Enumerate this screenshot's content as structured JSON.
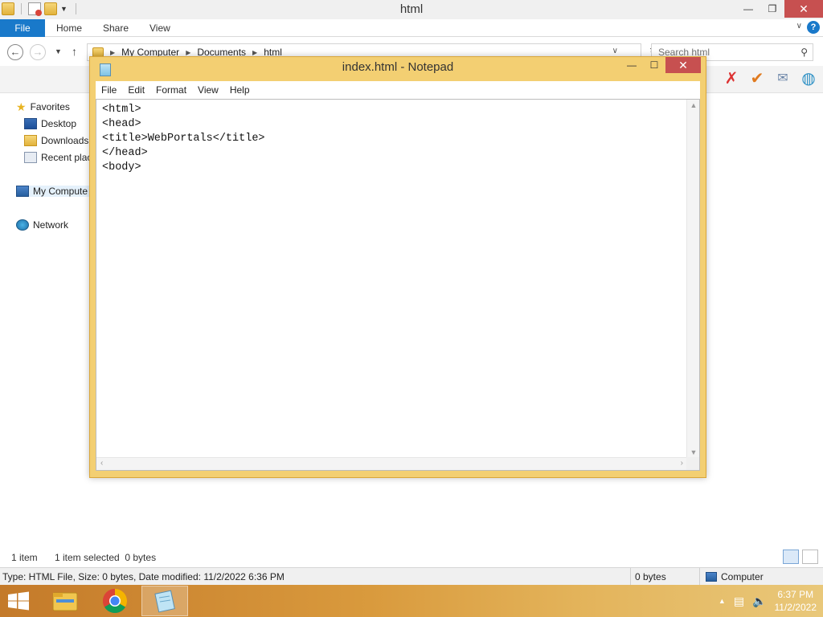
{
  "explorer": {
    "title": "html",
    "ribbon_tabs": [
      "File",
      "Home",
      "Share",
      "View"
    ],
    "breadcrumb": [
      "My Computer",
      "Documents",
      "html"
    ],
    "search_placeholder": "Search html",
    "nav": {
      "favorites": "Favorites",
      "desktop": "Desktop",
      "downloads": "Downloads",
      "recent": "Recent plac",
      "computer": "My Compute",
      "network": "Network"
    },
    "status": {
      "items": "1 item",
      "selected": "1 item selected  0 bytes"
    },
    "info": {
      "details": "Type: HTML File, Size: 0 bytes, Date modified: 11/2/2022 6:36 PM",
      "size": "0 bytes",
      "location": "Computer"
    }
  },
  "notepad": {
    "title": "index.html - Notepad",
    "menu": [
      "File",
      "Edit",
      "Format",
      "View",
      "Help"
    ],
    "content": "<html>\n<head>\n<title>WebPortals</title>\n</head>\n<body>"
  },
  "taskbar": {
    "time": "6:37 PM",
    "date": "11/2/2022"
  },
  "colors": {
    "file_tab": "#1979ca",
    "notepad_frame": "#f3cf72",
    "close_button": "#c75050",
    "taskbar": "#d99a3d"
  }
}
